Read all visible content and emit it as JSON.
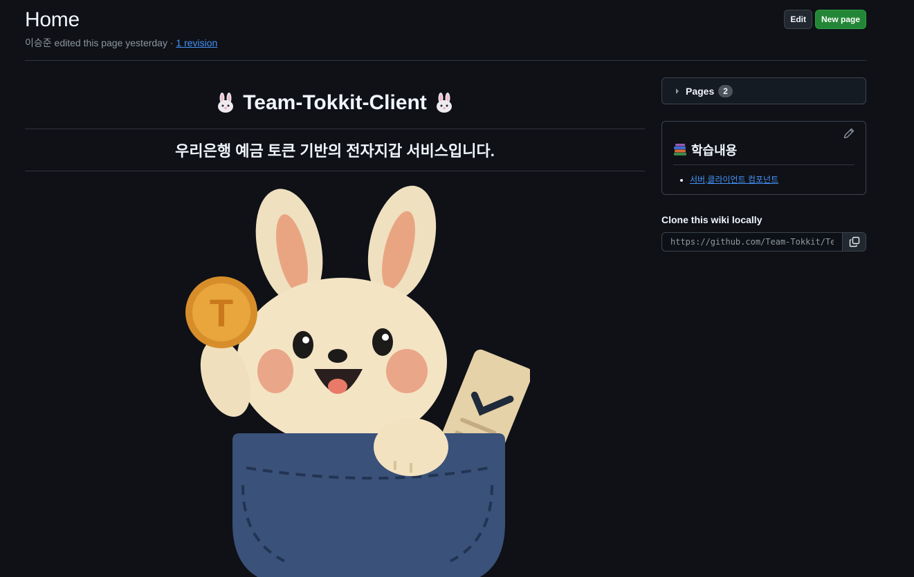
{
  "header": {
    "title": "Home",
    "editor": "이승준 edited this page yesterday · ",
    "revision_link": "1 revision",
    "edit_label": "Edit",
    "new_page_label": "New page"
  },
  "content": {
    "heading": "Team-Tokkit-Client",
    "heading_icon": "rabbit-face-emoji",
    "subheading": "우리은행 예금 토큰 기반의 전자지갑 서비스입니다.",
    "hero_image": "rabbit-in-pocket-holding-coin-illustration",
    "coin_letter": "T"
  },
  "sidebar": {
    "pages_label": "Pages",
    "pages_count": "2",
    "toc_title": "학습내용",
    "toc_icon": "books-emoji",
    "toc_items": [
      "서버,클라이언트 컴포넌트"
    ],
    "clone_label": "Clone this wiki locally",
    "clone_url": "https://github.com/Team-Tokkit/Team-Tokkit-Client.wiki.git"
  },
  "colors": {
    "background": "#0f1117",
    "link": "#4493f8",
    "primary_button": "#238636",
    "border": "#3d444d"
  }
}
